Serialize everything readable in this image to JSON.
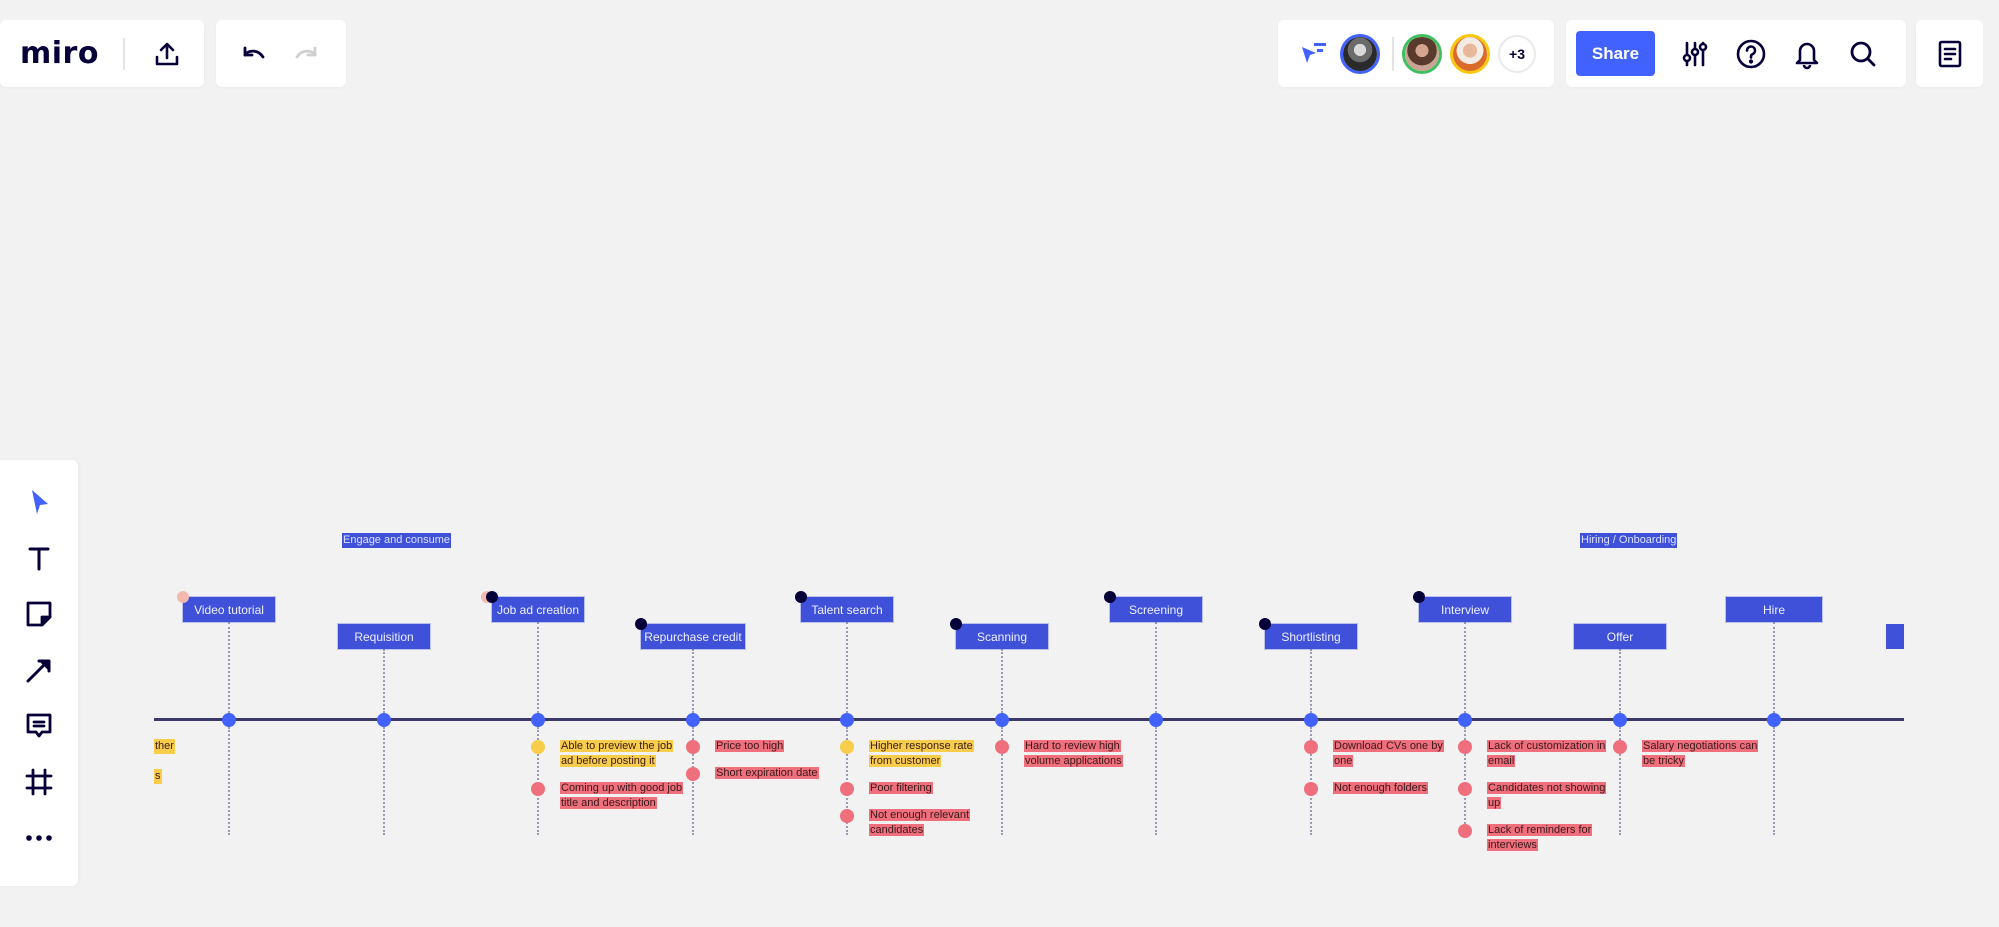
{
  "app": {
    "logo": "miro",
    "share_label": "Share",
    "collaborators_more": "+3",
    "colors": {
      "accent": "#4262ff",
      "stage_box": "#3f51d9",
      "positive_note": "#f7cd4b",
      "pain_note": "#ef6f7d",
      "canvas": "#f2f2f2"
    }
  },
  "toolbar_top": {
    "icons": [
      "export-icon",
      "undo-icon",
      "redo-icon",
      "cursor-filter-icon",
      "settings-sliders-icon",
      "help-icon",
      "bell-icon",
      "search-icon",
      "notes-icon"
    ],
    "collaborators": [
      {
        "name": "collaborator-1",
        "ring": "#4262ff"
      },
      {
        "name": "collaborator-2",
        "ring": "#3fbf5f"
      },
      {
        "name": "collaborator-3",
        "ring": "#fac710"
      }
    ]
  },
  "toolbar_left": {
    "tools": [
      "select-tool",
      "text-tool",
      "sticky-note-tool",
      "arrow-tool",
      "comment-tool",
      "frame-tool",
      "more-tools"
    ]
  },
  "board": {
    "phases": [
      {
        "label": "Engage and consume"
      },
      {
        "label": "Hiring / Onboarding"
      }
    ],
    "stages": [
      {
        "label": "Video tutorial",
        "notes": []
      },
      {
        "label": "Requisition",
        "notes": []
      },
      {
        "label": "Job ad creation",
        "notes": [
          {
            "type": "positive",
            "text": "Able to preview the job ad before posting it"
          },
          {
            "type": "pain",
            "text": "Coming up with good job title and description"
          }
        ]
      },
      {
        "label": "Repurchase credit",
        "notes": [
          {
            "type": "pain",
            "text": "Price too high"
          },
          {
            "type": "pain",
            "text": "Short expiration date"
          }
        ]
      },
      {
        "label": "Talent search",
        "notes": [
          {
            "type": "positive",
            "text": "Higher response rate from customer"
          },
          {
            "type": "pain",
            "text": "Poor filtering"
          },
          {
            "type": "pain",
            "text": "Not enough relevant candidates"
          }
        ]
      },
      {
        "label": "Scanning",
        "notes": [
          {
            "type": "pain",
            "text": "Hard to review high volume applications"
          }
        ]
      },
      {
        "label": "Screening",
        "notes": []
      },
      {
        "label": "Shortlisting",
        "notes": [
          {
            "type": "pain",
            "text": "Download CVs one by one"
          },
          {
            "type": "pain",
            "text": "Not enough folders"
          }
        ]
      },
      {
        "label": "Interview",
        "notes": [
          {
            "type": "pain",
            "text": "Lack of customization in email"
          },
          {
            "type": "pain",
            "text": "Candidates not showing up"
          },
          {
            "type": "pain",
            "text": "Lack of reminders for interviews"
          }
        ]
      },
      {
        "label": "Offer",
        "notes": [
          {
            "type": "pain",
            "text": "Salary negotiations can be tricky"
          }
        ]
      },
      {
        "label": "Hire",
        "notes": []
      }
    ],
    "stubs": [
      "ther",
      "s"
    ]
  }
}
